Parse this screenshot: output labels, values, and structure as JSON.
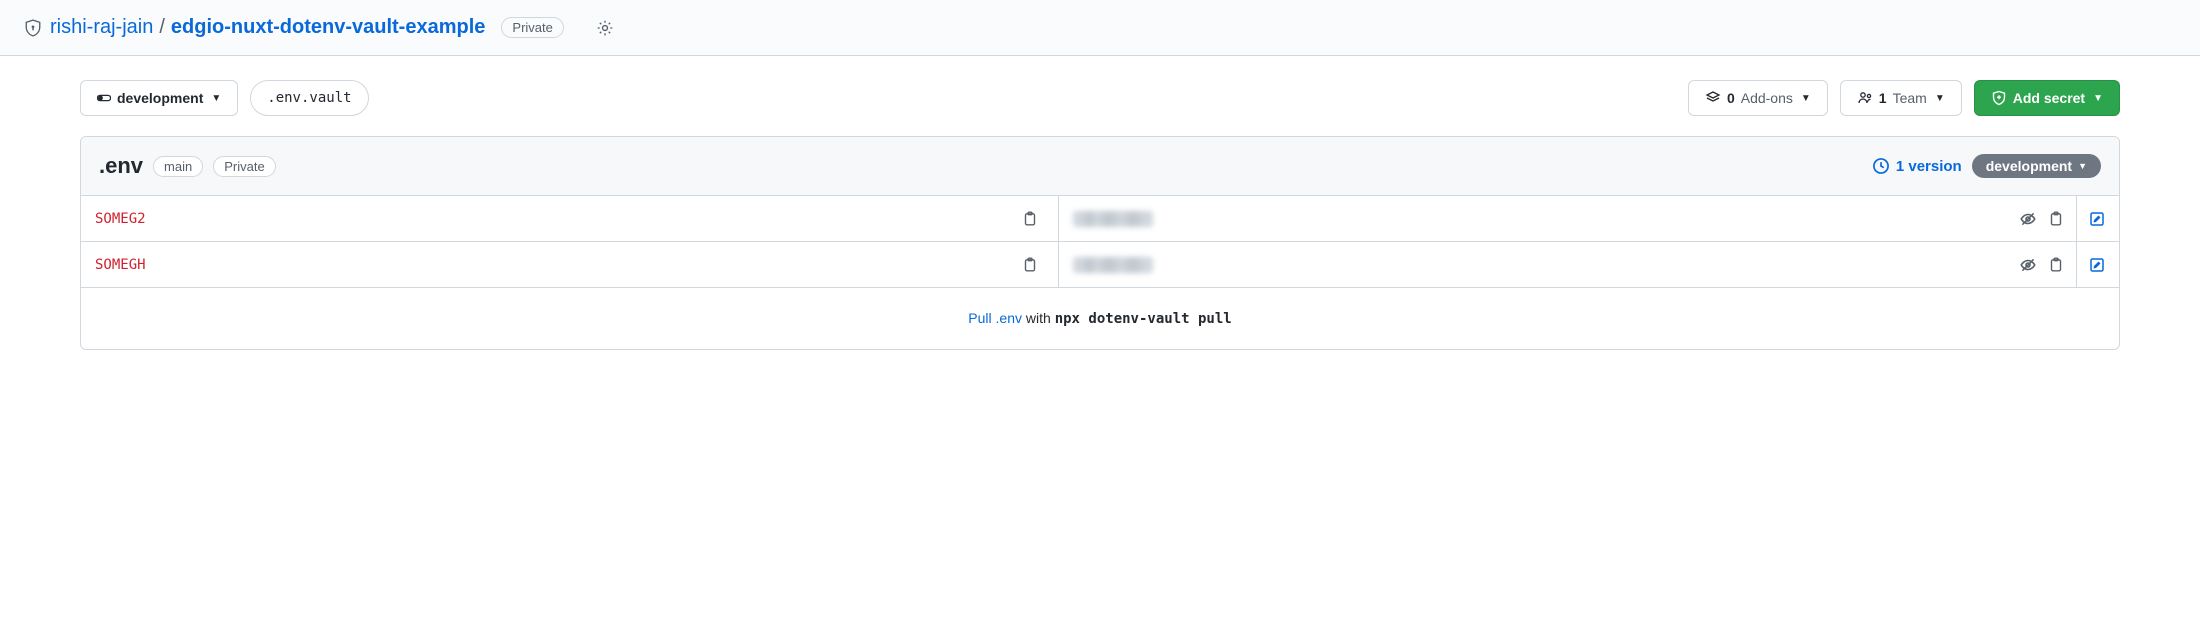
{
  "header": {
    "owner": "rishi-raj-jain",
    "separator": "/",
    "repo": "edgio-nuxt-dotenv-vault-example",
    "visibility_badge": "Private"
  },
  "toolbar": {
    "env_dropdown": "development",
    "env_file": ".env.vault",
    "addons_count": "0",
    "addons_label": "Add-ons",
    "team_count": "1",
    "team_label": "Team",
    "add_secret_label": "Add secret"
  },
  "panel": {
    "title": ".env",
    "branch_pill": "main",
    "visibility_pill": "Private",
    "versions_text": "1 version",
    "env_chip": "development"
  },
  "rows": [
    {
      "key": "SOMEG2"
    },
    {
      "key": "SOMEGH"
    }
  ],
  "footer": {
    "pull_link": "Pull .env",
    "with_text": " with ",
    "command": "npx dotenv-vault pull"
  }
}
